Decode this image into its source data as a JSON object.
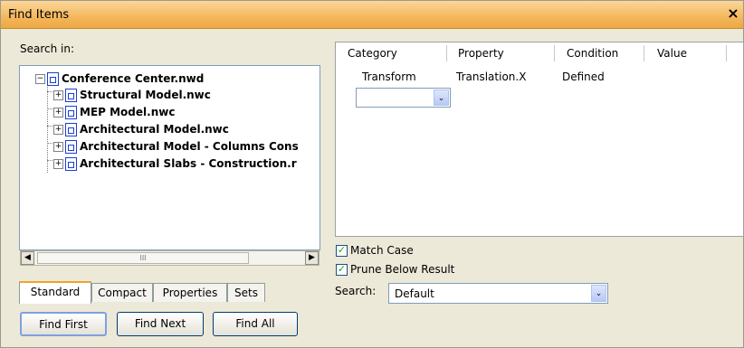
{
  "window": {
    "title": "Find Items",
    "close_glyph": "×"
  },
  "left": {
    "search_in_label": "Search in:",
    "tree": [
      {
        "label": "Conference Center.nwd",
        "expander": "⊟",
        "level": 0
      },
      {
        "label": "Structural Model.nwc",
        "expander": "⊞",
        "level": 1
      },
      {
        "label": "MEP Model.nwc",
        "expander": "⊞",
        "level": 1
      },
      {
        "label": "Architectural Model.nwc",
        "expander": "⊞",
        "level": 1
      },
      {
        "label": "Architectural Model - Columns Cons",
        "expander": "⊞",
        "level": 1
      },
      {
        "label": "Architectural Slabs - Construction.r",
        "expander": "⊞",
        "level": 1
      }
    ],
    "scroll_left_glyph": "◀",
    "scroll_right_glyph": "▶",
    "scroll_thumb_glyph": "III",
    "tabs": [
      {
        "label": "Standard",
        "active": true
      },
      {
        "label": "Compact",
        "active": false
      },
      {
        "label": "Properties",
        "active": false
      },
      {
        "label": "Sets",
        "active": false
      }
    ]
  },
  "grid": {
    "columns": [
      "Category",
      "Property",
      "Condition",
      "Value"
    ],
    "row": {
      "category": "Transform",
      "property": "Translation.X",
      "condition": "Defined",
      "value": ""
    },
    "dropdown_glyph": "⌄"
  },
  "options": {
    "match_case_label": "Match Case",
    "match_case_checked": true,
    "prune_label": "Prune Below Result",
    "prune_checked": true,
    "check_glyph": "✓",
    "search_label": "Search:",
    "search_value": "Default"
  },
  "buttons": {
    "find_first": "Find First",
    "find_next": "Find Next",
    "find_all": "Find All"
  },
  "colors": {
    "title_bar": "#f4b75c",
    "active_tab_accent": "#f0a42c",
    "checkbox_check": "#21a121",
    "icon_blue": "#1b3fd0"
  },
  "icons": {
    "tree_item": "model-file-icon",
    "expander_collapsed": "plus-box-icon",
    "expander_expanded": "minus-box-icon",
    "dropdown": "chevron-down-icon",
    "close": "close-icon"
  }
}
